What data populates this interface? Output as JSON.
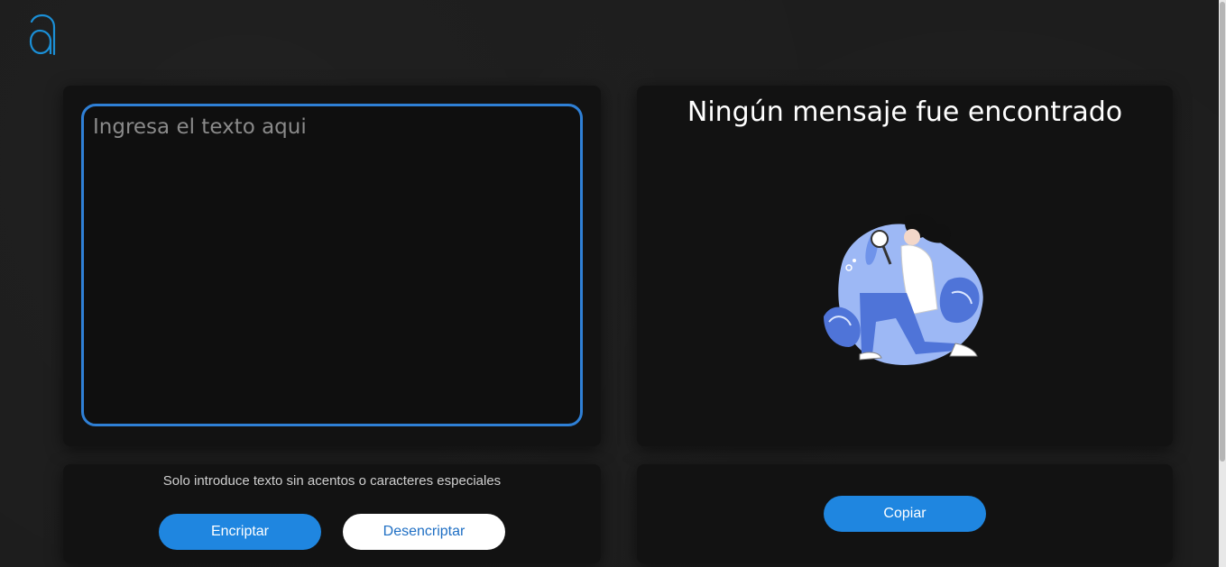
{
  "header": {
    "logo_icon": "a-letter-logo-icon"
  },
  "input_panel": {
    "placeholder": "Ingresa el texto aqui",
    "value": ""
  },
  "output_panel": {
    "title": "Ningún mensaje fue encontrado",
    "illustration_icon": "person-with-magnifying-glass-illustration"
  },
  "actions": {
    "hint": "Solo introduce texto sin acentos o caracteres especiales",
    "encrypt_label": "Encriptar",
    "decrypt_label": "Desencriptar"
  },
  "copy": {
    "copy_label": "Copiar"
  },
  "colors": {
    "accent": "#1f86e0",
    "border": "#2f80d6",
    "background": "#1c1c1c",
    "card": "#121212"
  }
}
